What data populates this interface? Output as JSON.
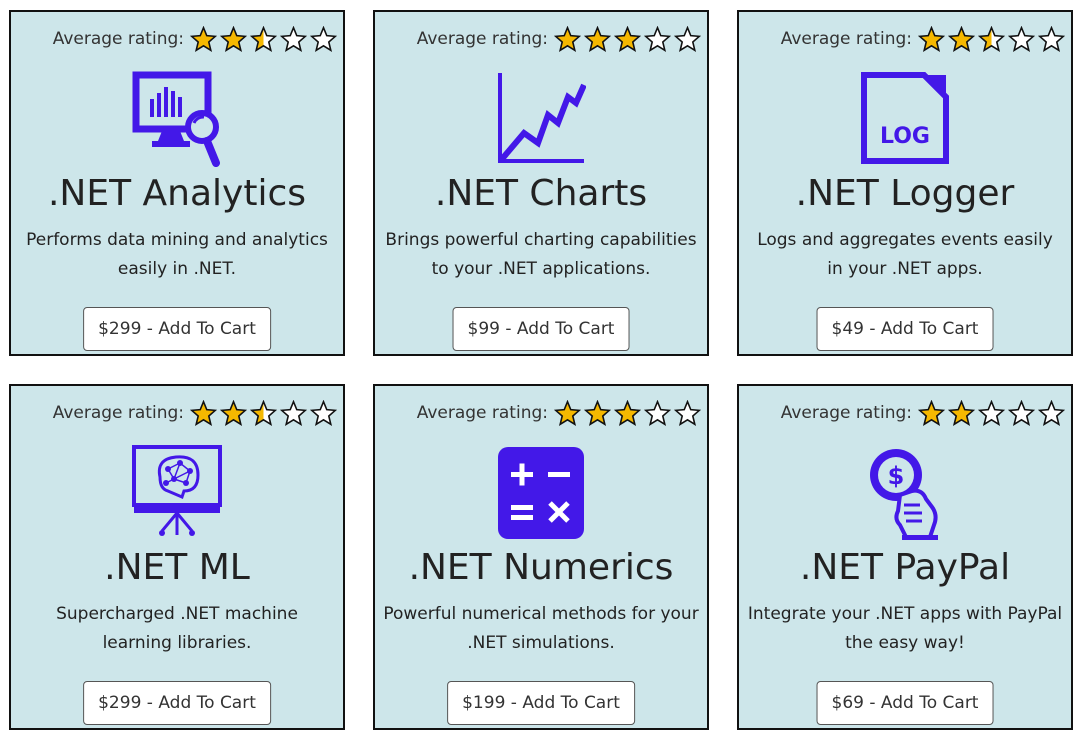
{
  "rating_label": "Average rating:",
  "colors": {
    "card_background": "#cde6ea",
    "icon": "#4318e8",
    "star_fill": "#f5b800"
  },
  "products": [
    {
      "name": ".NET Analytics",
      "description": "Performs data mining and analytics easily in .NET.",
      "button_label": "$299 - Add To Cart",
      "rating": 2.5,
      "icon": "analytics-monitor-magnifier-icon"
    },
    {
      "name": ".NET Charts",
      "description": "Brings powerful charting capabilities to your .NET applications.",
      "button_label": "$99 - Add To Cart",
      "rating": 3,
      "icon": "line-chart-icon"
    },
    {
      "name": ".NET Logger",
      "description": "Logs and aggregates events easily in your .NET apps.",
      "button_label": "$49 - Add To Cart",
      "rating": 2.5,
      "icon": "log-file-icon",
      "icon_text": "LOG"
    },
    {
      "name": ".NET ML",
      "description": "Supercharged .NET machine learning libraries.",
      "button_label": "$299 - Add To Cart",
      "rating": 2.5,
      "icon": "machine-learning-brain-icon"
    },
    {
      "name": ".NET Numerics",
      "description": "Powerful numerical methods for your .NET simulations.",
      "button_label": "$199 - Add To Cart",
      "rating": 3,
      "icon": "calculator-icon"
    },
    {
      "name": ".NET PayPal",
      "description": "Integrate your .NET apps with PayPal the easy way!",
      "button_label": "$69 - Add To Cart",
      "rating": 2,
      "icon": "money-hand-icon"
    }
  ]
}
